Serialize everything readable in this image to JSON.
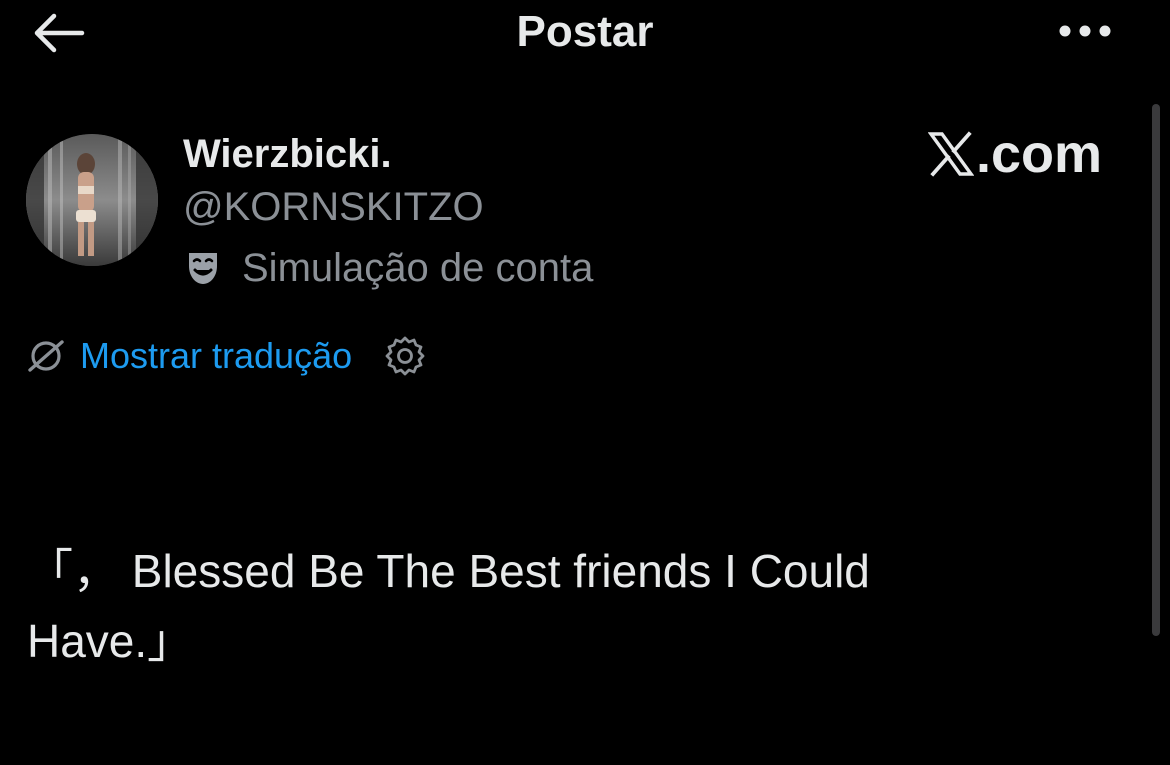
{
  "header": {
    "title": "Postar",
    "back_icon": "arrow-left-icon",
    "more_icon": "ellipsis-icon"
  },
  "author": {
    "display_name": "Wierzbicki.",
    "handle": "@KORNSKITZO",
    "label_icon": "parody-mask-icon",
    "label_text": "Simulação de conta"
  },
  "brand": {
    "logo_icon": "x-logo-icon",
    "text": ".com"
  },
  "translation": {
    "icon": "translate-globe-icon",
    "link_text": "Mostrar tradução",
    "settings_icon": "gear-icon"
  },
  "post": {
    "line1": "「， Blessed Be The Best friends I Could",
    "line2": "Have.」"
  },
  "colors": {
    "background": "#000000",
    "primary_text": "#e7e9ea",
    "secondary_text": "#8b9096",
    "link": "#1d9bf0"
  }
}
